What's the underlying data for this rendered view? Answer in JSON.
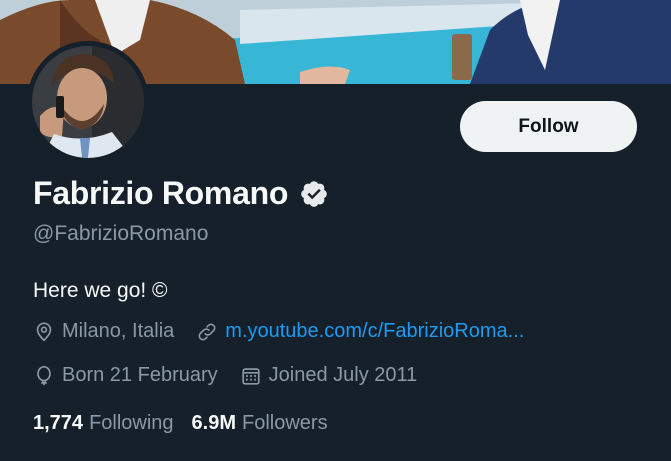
{
  "profile": {
    "display_name": "Fabrizio Romano",
    "handle": "@FabrizioRomano",
    "bio": "Here we go! ©",
    "location": "Milano, Italia",
    "website": "m.youtube.com/c/FabrizioRoma...",
    "birthday": "Born 21 February",
    "joined": "Joined July 2011"
  },
  "stats": {
    "following_count": "1,774",
    "following_label": "Following",
    "followers_count": "6.9M",
    "followers_label": "Followers"
  },
  "actions": {
    "follow_label": "Follow"
  },
  "colors": {
    "background": "#15202b",
    "primary_text": "#f7f9f9",
    "secondary_text": "#8b98a5",
    "link": "#1d9bf0",
    "follow_button_bg": "#eff3f4"
  },
  "icons": {
    "verified": "verified-badge-icon",
    "location": "location-pin-icon",
    "website": "link-icon",
    "birthday": "balloon-icon",
    "joined": "calendar-icon"
  }
}
